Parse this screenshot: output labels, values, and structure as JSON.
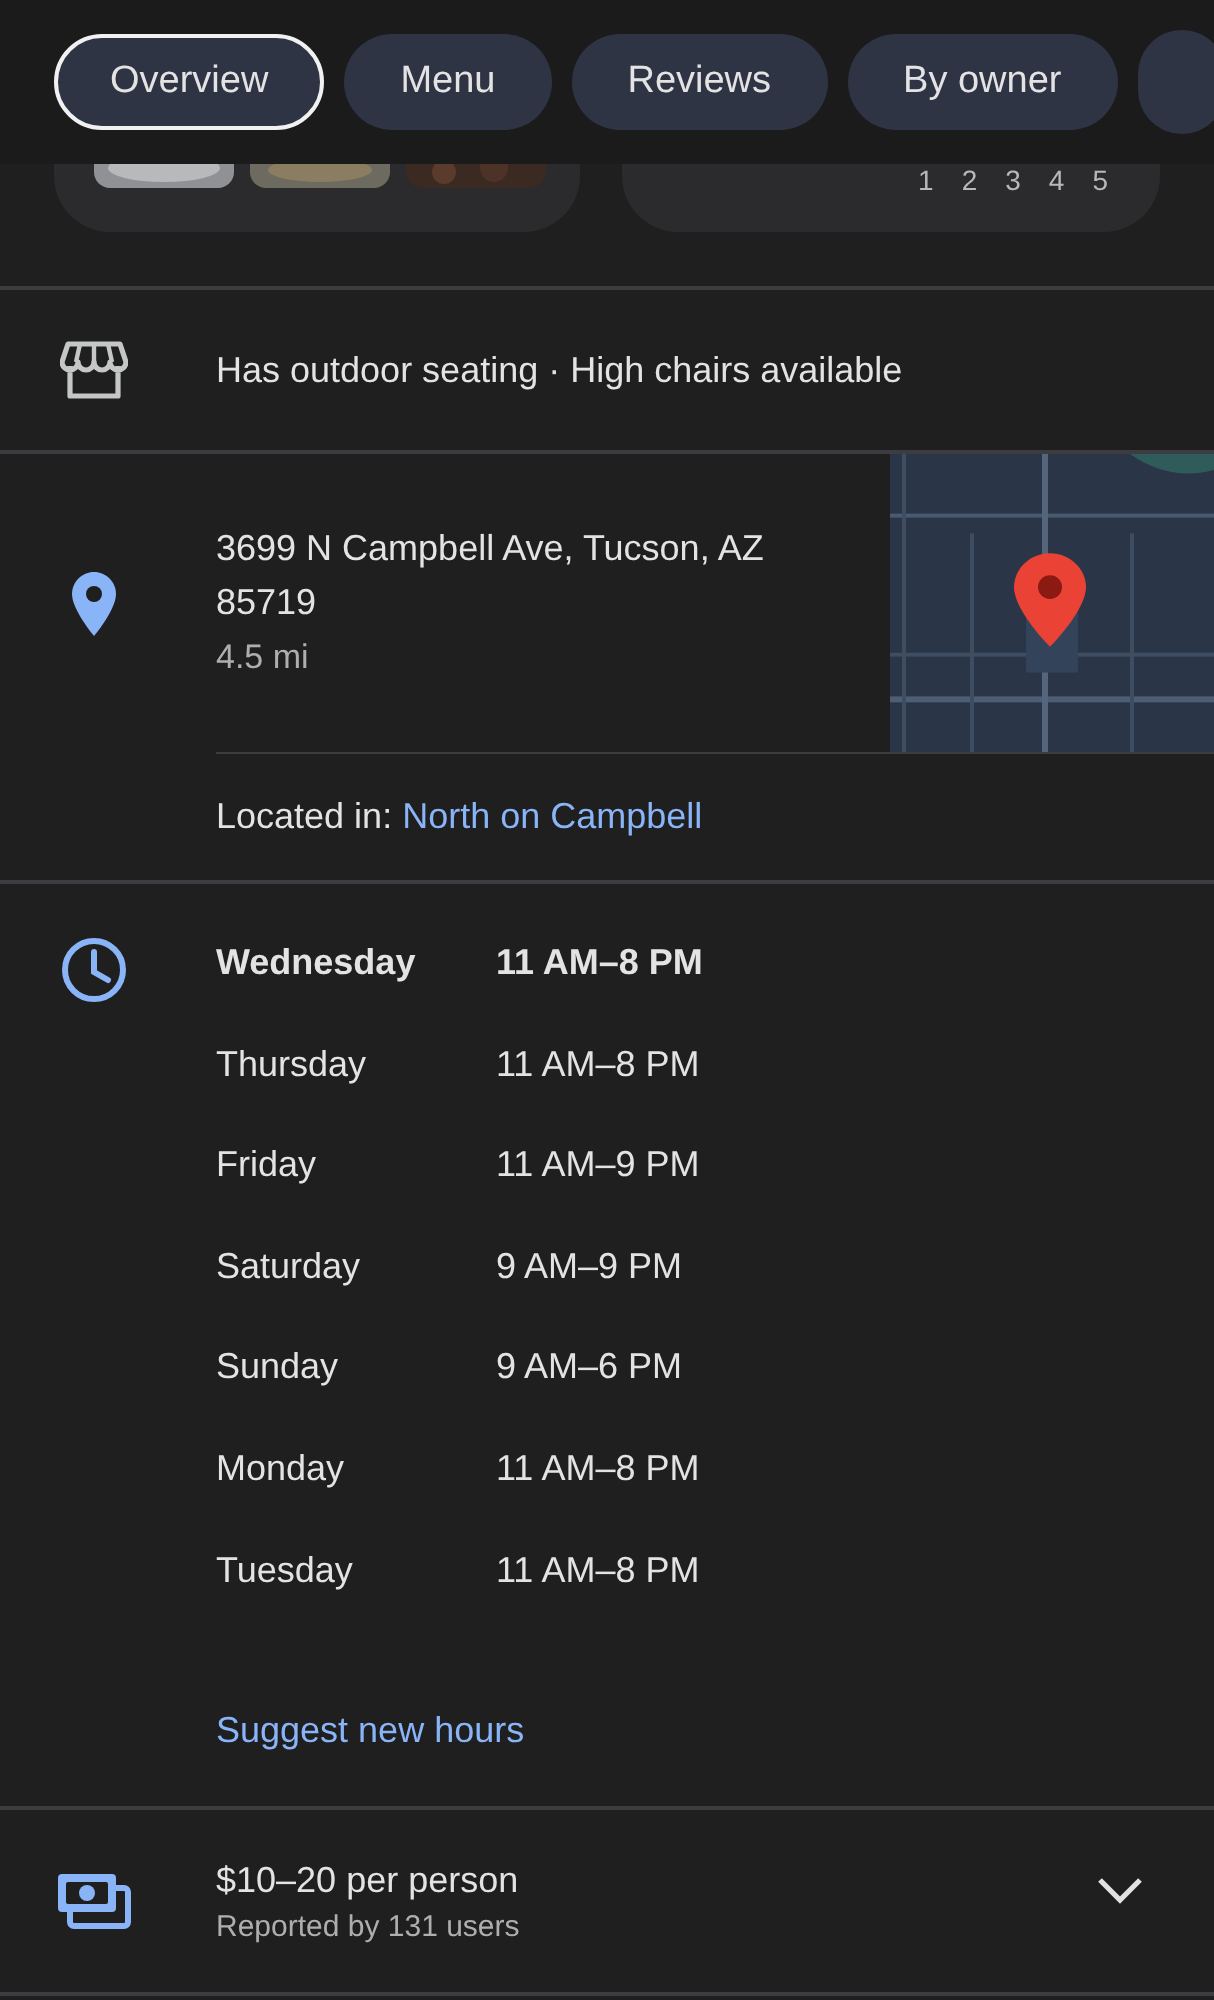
{
  "tabs": [
    {
      "label": "Overview",
      "selected": true
    },
    {
      "label": "Menu",
      "selected": false
    },
    {
      "label": "Reviews",
      "selected": false
    },
    {
      "label": "By owner",
      "selected": false
    }
  ],
  "cards": {
    "pages": [
      "1",
      "2",
      "3",
      "4",
      "5"
    ]
  },
  "amenities": {
    "text": "Has outdoor seating · High chairs available"
  },
  "address": {
    "lines": [
      "3699 N Campbell Ave, Tucson, AZ",
      "85719"
    ],
    "distance": "4.5 mi"
  },
  "located_in": {
    "label": "Located in:",
    "link": "North on Campbell"
  },
  "hours": {
    "days": [
      {
        "day": "Wednesday",
        "hours": "11 AM–8 PM",
        "current": true
      },
      {
        "day": "Thursday",
        "hours": "11 AM–8 PM",
        "current": false
      },
      {
        "day": "Friday",
        "hours": "11 AM–9 PM",
        "current": false
      },
      {
        "day": "Saturday",
        "hours": "9 AM–9 PM",
        "current": false
      },
      {
        "day": "Sunday",
        "hours": "9 AM–6 PM",
        "current": false
      },
      {
        "day": "Monday",
        "hours": "11 AM–8 PM",
        "current": false
      },
      {
        "day": "Tuesday",
        "hours": "11 AM–8 PM",
        "current": false
      }
    ],
    "suggest_link": "Suggest new hours"
  },
  "price": {
    "text": "$10–20 per person",
    "note": "Reported by 131 users",
    "expanded": false
  }
}
